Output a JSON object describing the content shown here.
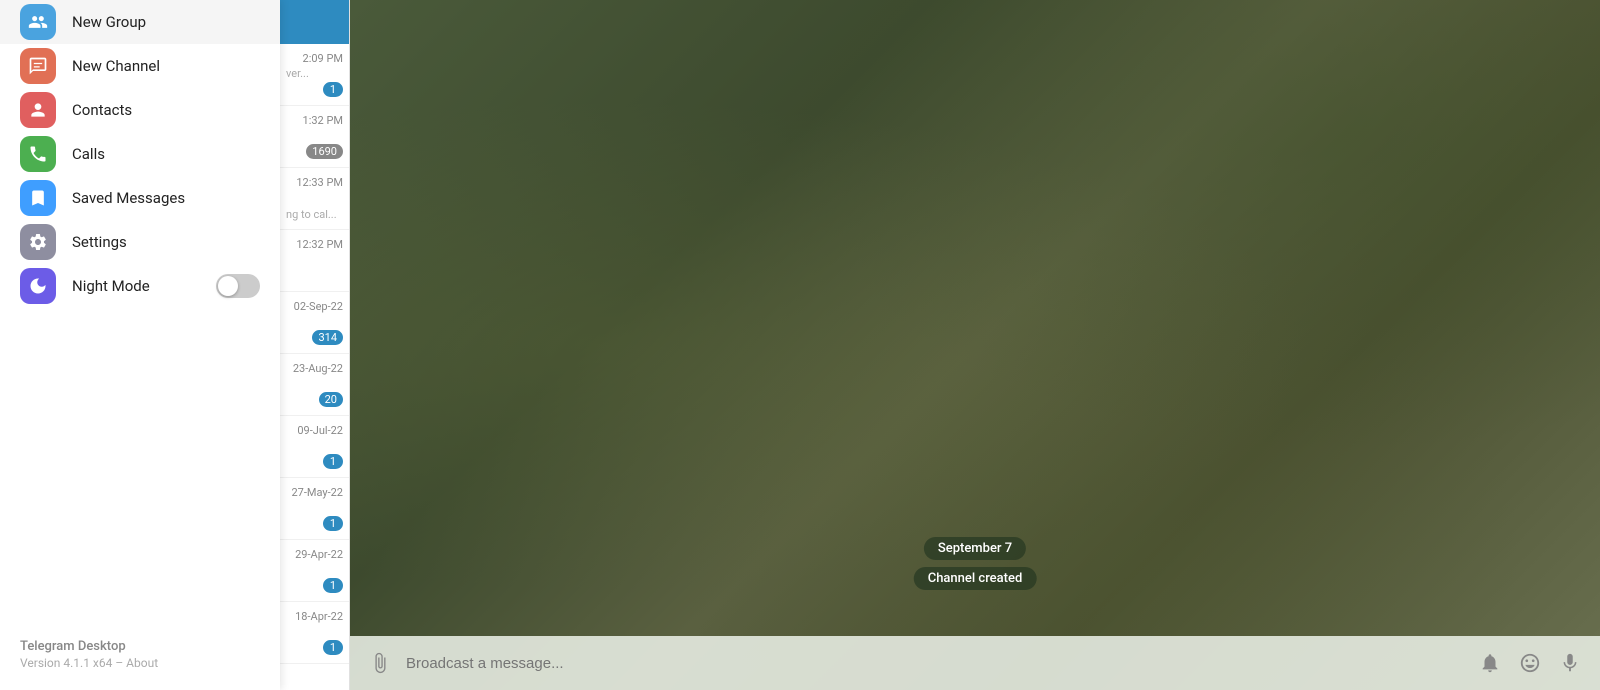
{
  "sidebar": {
    "menu_items": [
      {
        "id": "new-group",
        "label": "New Group",
        "icon_color": "#4aa3df",
        "icon_type": "group"
      },
      {
        "id": "new-channel",
        "label": "New Channel",
        "icon_color": "#e17055",
        "icon_type": "channel"
      },
      {
        "id": "contacts",
        "label": "Contacts",
        "icon_color": "#e05f5f",
        "icon_type": "contacts"
      },
      {
        "id": "calls",
        "label": "Calls",
        "icon_color": "#4caf50",
        "icon_type": "calls"
      },
      {
        "id": "saved-messages",
        "label": "Saved Messages",
        "icon_color": "#3f9eff",
        "icon_type": "saved"
      },
      {
        "id": "settings",
        "label": "Settings",
        "icon_color": "#8e8ea0",
        "icon_type": "settings"
      },
      {
        "id": "night-mode",
        "label": "Night Mode",
        "icon_color": "#6c5ce7",
        "icon_type": "night",
        "has_toggle": true,
        "toggle_state": false
      }
    ],
    "footer": {
      "app_name": "Telegram Desktop",
      "version_text": "Version 4.1.1 x64 – About"
    }
  },
  "chat_list": {
    "items": [
      {
        "time": "2:09 PM",
        "preview": "ver...",
        "badge": "1",
        "badge_type": "blue"
      },
      {
        "time": "1:32 PM",
        "preview": "",
        "badge": "1690",
        "badge_type": "gray"
      },
      {
        "time": "12:33 PM",
        "preview": "ng to cal...",
        "badge": "",
        "badge_type": ""
      },
      {
        "time": "12:32 PM",
        "preview": "",
        "badge": "",
        "badge_type": ""
      },
      {
        "time": "02-Sep-22",
        "preview": "",
        "badge": "314",
        "badge_type": "blue"
      },
      {
        "time": "23-Aug-22",
        "preview": "",
        "badge": "20",
        "badge_type": "blue"
      },
      {
        "time": "09-Jul-22",
        "preview": "",
        "badge": "1",
        "badge_type": "blue"
      },
      {
        "time": "27-May-22",
        "preview": "",
        "badge": "1",
        "badge_type": "blue"
      },
      {
        "time": "29-Apr-22",
        "preview": "",
        "badge": "1",
        "badge_type": "blue"
      },
      {
        "time": "18-Apr-22",
        "preview": "",
        "badge": "1",
        "badge_type": "blue"
      }
    ]
  },
  "main_chat": {
    "date_label": "September 7",
    "system_message": "Channel created",
    "input_placeholder": "Broadcast a message..."
  },
  "input_bar": {
    "attach_icon": "📎",
    "emoji_icon": "😊",
    "mic_icon": "🎤"
  }
}
